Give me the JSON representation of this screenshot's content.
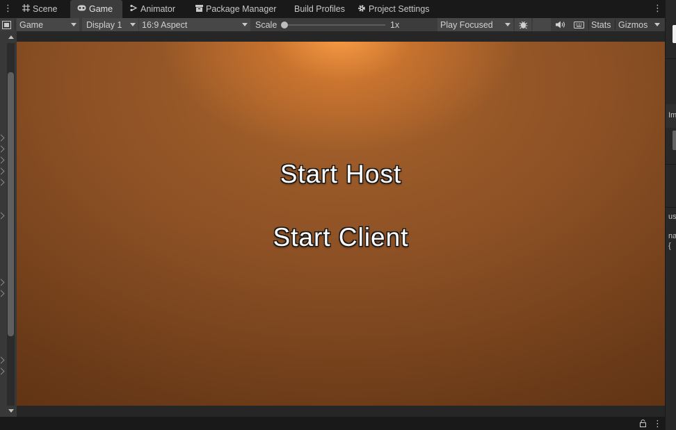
{
  "tabs": [
    {
      "label": "Scene",
      "icon": "grid-icon"
    },
    {
      "label": "Game",
      "icon": "gamepad-icon",
      "active": true
    },
    {
      "label": "Animator",
      "icon": "animator-icon"
    },
    {
      "label": "Package Manager",
      "icon": "package-icon"
    },
    {
      "label": "Build Profiles",
      "icon": ""
    },
    {
      "label": "Project Settings",
      "icon": "gear-icon"
    }
  ],
  "toolbar": {
    "view_mode": "Game",
    "display": "Display 1",
    "aspect": "16:9 Aspect",
    "scale_label": "Scale",
    "scale_value": "1x",
    "scale_fraction": 0.0,
    "play_mode": "Play Focused",
    "stats_label": "Stats",
    "gizmos_label": "Gizmos"
  },
  "game": {
    "start_host": "Start Host",
    "start_client": "Start Client"
  },
  "right_panel": {
    "fragments": [
      "Im",
      "us",
      "na",
      "{"
    ]
  },
  "colors": {
    "tab_active_bg": "#3c3c3c",
    "toolbar_bg": "#3c3c3c",
    "game_bg_center": "#a9642c",
    "game_bg_edge": "#5c3114",
    "highlight": "#ffa046"
  }
}
